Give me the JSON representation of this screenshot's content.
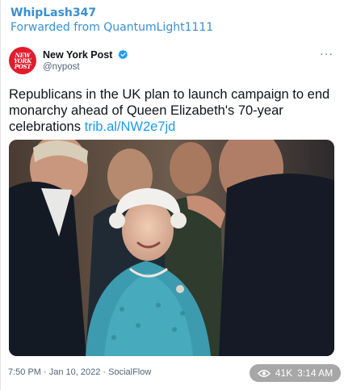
{
  "message": {
    "sender": "WhipLash347",
    "forwarded_from": "Forwarded from QuantumLight1111"
  },
  "tweet": {
    "account_name": "New York Post",
    "handle": "@nypost",
    "avatar_text": [
      "NEW",
      "YORK",
      "POST"
    ],
    "text": "Republicans in the UK plan to launch campaign to end monarchy ahead of Queen Elizabeth's 70-year celebrations ",
    "link": "trib.al/NW2e7jd",
    "more_icon": "more-horizontal-icon",
    "verified_icon": "verified-badge-icon",
    "meta": "7:50 PM · Jan 10, 2022 · SocialFlow"
  },
  "footer": {
    "views": "41K",
    "time": "3:14 AM",
    "views_icon": "eye-icon"
  },
  "colors": {
    "accent": "#3a8fd1",
    "link": "#1d9bf0",
    "verified": "#1d9bf0",
    "brand_red": "#e11d2b",
    "badge_bg": "#a7a7a7"
  }
}
